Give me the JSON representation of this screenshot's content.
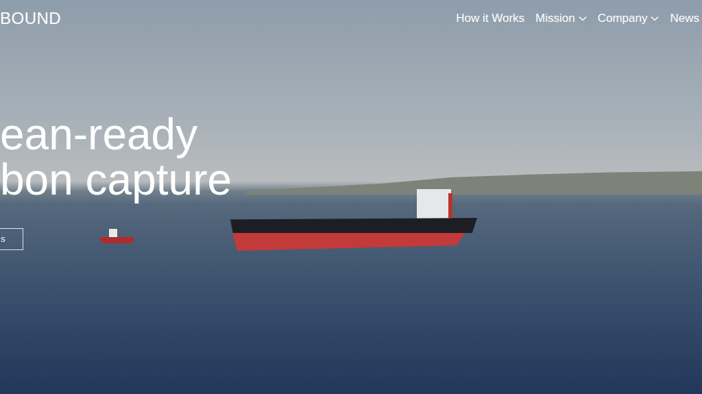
{
  "logo": "BOUND",
  "nav": [
    {
      "label": "How it Works",
      "has_menu": false
    },
    {
      "label": "Mission",
      "has_menu": true
    },
    {
      "label": "Company",
      "has_menu": true
    },
    {
      "label": "News",
      "has_menu": false
    }
  ],
  "hero": {
    "headline": [
      "ean-ready",
      "bon capture"
    ],
    "button": "s"
  }
}
